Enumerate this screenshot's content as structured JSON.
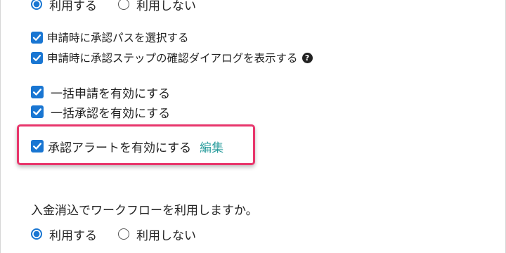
{
  "top_radio": {
    "option_use": "利用する",
    "option_not_use": "利用しない"
  },
  "settings": {
    "select_approval_path": "申請時に承認パスを選択する",
    "show_step_dialog": "申請時に承認ステップの確認ダイアログを表示する",
    "help_icon_glyph": "?",
    "bulk_apply": "一括申請を有効にする",
    "bulk_approve": "一括承認を有効にする",
    "approval_alert": "承認アラートを有効にする",
    "edit_link": "編集"
  },
  "deposit": {
    "question": "入金消込でワークフローを利用しますか。",
    "option_use": "利用する",
    "option_not_use": "利用しない"
  },
  "colors": {
    "accent": "#1976d2",
    "highlight": "#e8366c",
    "link": "#2a9d9d"
  }
}
